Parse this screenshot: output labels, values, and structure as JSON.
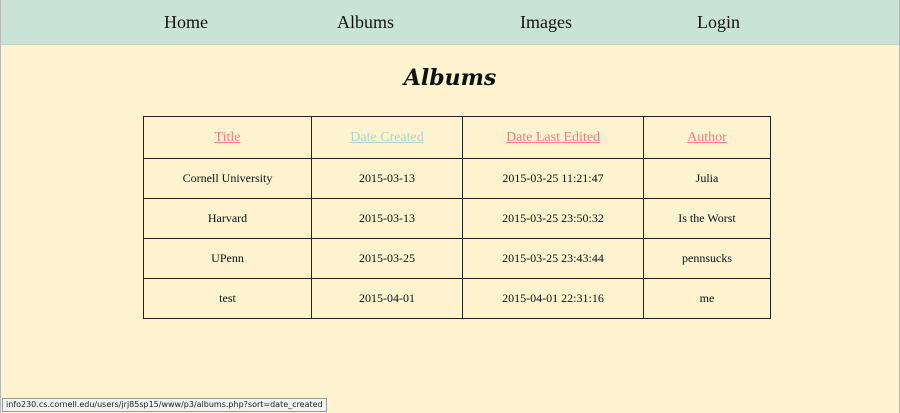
{
  "nav": {
    "home": "Home",
    "albums": "Albums",
    "images": "Images",
    "login": "Login"
  },
  "page_title": "Albums",
  "table": {
    "headers": {
      "title": "Title",
      "date_created": "Date Created",
      "date_last_edited": "Date Last Edited",
      "author": "Author"
    },
    "rows": [
      {
        "title": "Cornell University",
        "date_created": "2015-03-13",
        "date_last_edited": "2015-03-25 11:21:47",
        "author": "Julia"
      },
      {
        "title": "Harvard",
        "date_created": "2015-03-13",
        "date_last_edited": "2015-03-25 23:50:32",
        "author": "Is the Worst"
      },
      {
        "title": "UPenn",
        "date_created": "2015-03-25",
        "date_last_edited": "2015-03-25 23:43:44",
        "author": "pennsucks"
      },
      {
        "title": "test",
        "date_created": "2015-04-01",
        "date_last_edited": "2015-04-01 22:31:16",
        "author": "me"
      }
    ]
  },
  "status_bar": {
    "url": "info230.cs.cornell.edu/users/jrj85sp15/www/p3/albums.php?sort=date_created"
  },
  "colors": {
    "background": "#fdf4cf",
    "navbar": "#c9e3d6",
    "link_pink": "#ee7f8e",
    "link_hover_teal": "#a7d7d0"
  }
}
